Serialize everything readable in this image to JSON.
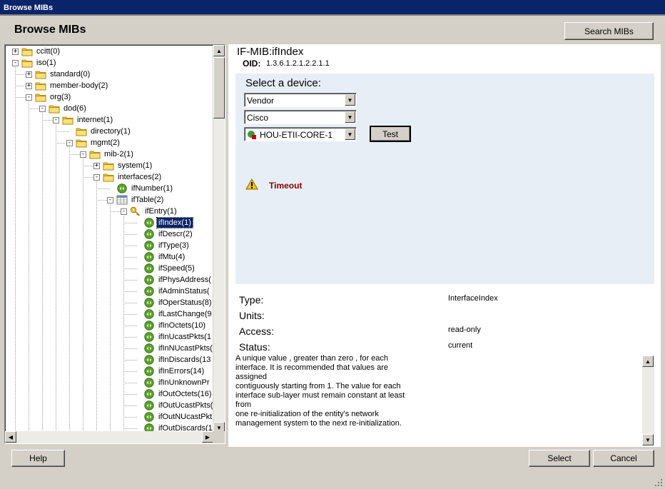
{
  "window": {
    "title": "Browse MIBs"
  },
  "header": {
    "title": "Browse MIBs",
    "search_button": "Search MIBs"
  },
  "tree": {
    "nodes": [
      {
        "label": "ccitt(0)",
        "level": 0,
        "icon": "folder-icon",
        "expander": "+"
      },
      {
        "label": "iso(1)",
        "level": 0,
        "icon": "folder-icon",
        "expander": "-"
      },
      {
        "label": "standard(0)",
        "level": 1,
        "icon": "folder-icon",
        "expander": "+"
      },
      {
        "label": "member-body(2)",
        "level": 1,
        "icon": "folder-icon",
        "expander": "+"
      },
      {
        "label": "org(3)",
        "level": 1,
        "icon": "folder-icon",
        "expander": "-"
      },
      {
        "label": "dod(6)",
        "level": 2,
        "icon": "folder-icon",
        "expander": "-"
      },
      {
        "label": "internet(1)",
        "level": 3,
        "icon": "folder-icon",
        "expander": "-"
      },
      {
        "label": "directory(1)",
        "level": 4,
        "icon": "folder-icon",
        "expander": ""
      },
      {
        "label": "mgmt(2)",
        "level": 4,
        "icon": "folder-icon",
        "expander": "-"
      },
      {
        "label": "mib-2(1)",
        "level": 5,
        "icon": "folder-icon",
        "expander": "-"
      },
      {
        "label": "system(1)",
        "level": 6,
        "icon": "folder-icon",
        "expander": "+"
      },
      {
        "label": "interfaces(2)",
        "level": 6,
        "icon": "folder-icon",
        "expander": "-"
      },
      {
        "label": "ifNumber(1)",
        "level": 7,
        "icon": "leaf-icon",
        "expander": ""
      },
      {
        "label": "ifTable(2)",
        "level": 7,
        "icon": "table-icon",
        "expander": "-"
      },
      {
        "label": "ifEntry(1)",
        "level": 8,
        "icon": "key-icon",
        "expander": "-"
      },
      {
        "label": "ifIndex(1)",
        "level": 9,
        "icon": "leaf-icon",
        "expander": "",
        "selected": true
      },
      {
        "label": "ifDescr(2)",
        "level": 9,
        "icon": "leaf-icon",
        "expander": ""
      },
      {
        "label": "ifType(3)",
        "level": 9,
        "icon": "leaf-icon",
        "expander": ""
      },
      {
        "label": "ifMtu(4)",
        "level": 9,
        "icon": "leaf-icon",
        "expander": ""
      },
      {
        "label": "ifSpeed(5)",
        "level": 9,
        "icon": "leaf-icon",
        "expander": ""
      },
      {
        "label": "ifPhysAddress(",
        "level": 9,
        "icon": "leaf-icon",
        "expander": ""
      },
      {
        "label": "ifAdminStatus(",
        "level": 9,
        "icon": "leaf-icon",
        "expander": ""
      },
      {
        "label": "ifOperStatus(8)",
        "level": 9,
        "icon": "leaf-icon",
        "expander": ""
      },
      {
        "label": "ifLastChange(9",
        "level": 9,
        "icon": "leaf-icon",
        "expander": ""
      },
      {
        "label": "ifInOctets(10)",
        "level": 9,
        "icon": "leaf-icon",
        "expander": ""
      },
      {
        "label": "ifInUcastPkts(1",
        "level": 9,
        "icon": "leaf-icon",
        "expander": ""
      },
      {
        "label": "ifInNUcastPkts(",
        "level": 9,
        "icon": "leaf-icon",
        "expander": ""
      },
      {
        "label": "ifInDiscards(13",
        "level": 9,
        "icon": "leaf-icon",
        "expander": ""
      },
      {
        "label": "ifInErrors(14)",
        "level": 9,
        "icon": "leaf-icon",
        "expander": ""
      },
      {
        "label": "ifInUnknownPr",
        "level": 9,
        "icon": "leaf-icon",
        "expander": ""
      },
      {
        "label": "ifOutOctets(16)",
        "level": 9,
        "icon": "leaf-icon",
        "expander": ""
      },
      {
        "label": "ifOutUcastPkts(",
        "level": 9,
        "icon": "leaf-icon",
        "expander": ""
      },
      {
        "label": "ifOutNUcastPkt",
        "level": 9,
        "icon": "leaf-icon",
        "expander": ""
      },
      {
        "label": "ifOutDiscards(1",
        "level": 9,
        "icon": "leaf-icon",
        "expander": ""
      }
    ]
  },
  "details": {
    "mib_title": "IF-MIB:ifIndex",
    "oid_label": "OID:",
    "oid_value": "1.3.6.1.2.1.2.2.1.1",
    "device": {
      "heading": "Select a device:",
      "vendor_select": "Vendor",
      "vendor_value_select": "Cisco",
      "device_select": "HOU-ETII-CORE-1",
      "test_button": "Test",
      "status_text": "Timeout"
    },
    "properties": {
      "type_label": "Type:",
      "type_value": "InterfaceIndex",
      "units_label": "Units:",
      "units_value": "",
      "access_label": "Access:",
      "access_value": "read-only",
      "status_label": "Status:",
      "status_value": "current"
    },
    "description": "A unique value , greater than zero , for each\ninterface. It is recommended that values are assigned\ncontiguously starting from 1. The value for each\ninterface sub-layer must remain constant at least from\none re-initialization of the entity's network\nmanagement system to the next re-initialization."
  },
  "footer": {
    "help_button": "Help",
    "select_button": "Select",
    "cancel_button": "Cancel"
  },
  "colors": {
    "titlebar": "#0a246a",
    "selection": "#0a246a",
    "device_box": "#e8eef5",
    "timeout": "#8b0000",
    "folder": "#f5c842",
    "leaf": "#5aa02c"
  }
}
